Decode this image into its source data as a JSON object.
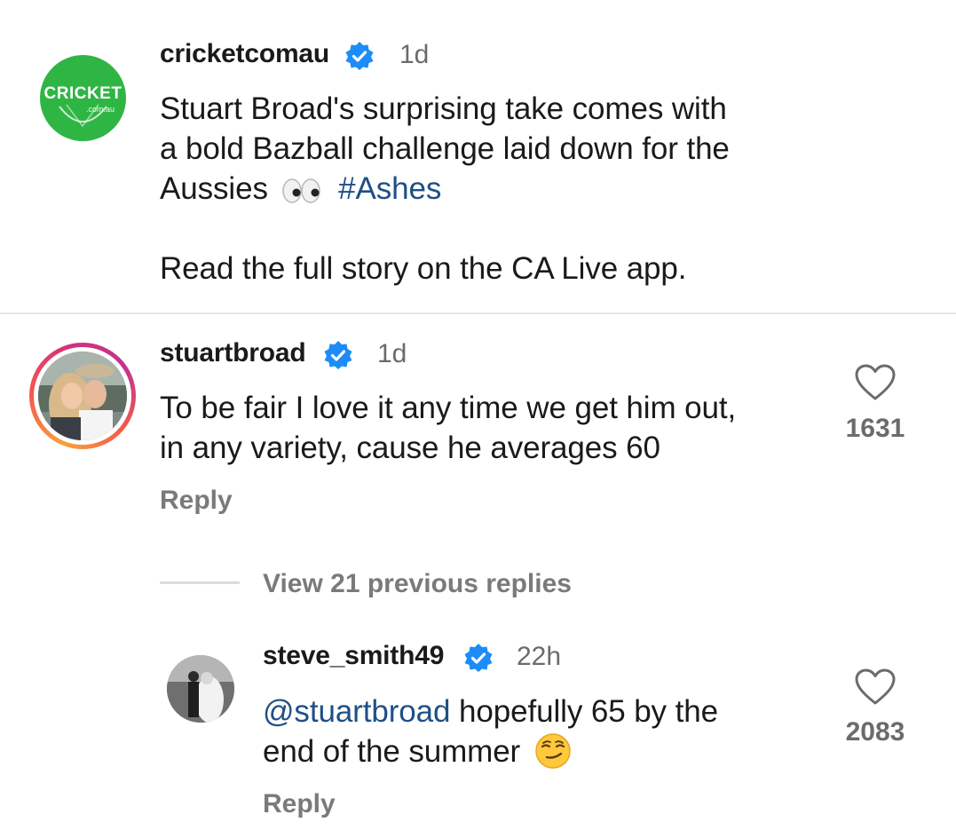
{
  "colors": {
    "verified_blue": "#1d8cf8",
    "link_blue": "#1f4f86",
    "cricket_green": "#2fb544",
    "muted_gray": "#6b6b6b"
  },
  "caption": {
    "username": "cricketcomau",
    "time": "1d",
    "avatar_logo_main": "CRICKET",
    "avatar_logo_sub": ".com.au",
    "line1": "Stuart Broad's surprising take comes with",
    "line2": "a bold Bazball challenge laid down for the",
    "line3_text": "Aussies",
    "line3_emoji_icon": "eyes-emoji-icon",
    "line3_hashtag": "#Ashes",
    "line4": "Read the full story on the CA Live app."
  },
  "comment1": {
    "username": "stuartbroad",
    "time": "1d",
    "line1": "To be fair I love it any time we get him out,",
    "line2": "in any variety, cause he averages 60",
    "reply_label": "Reply",
    "like_icon": "heart-icon",
    "likes": "1631"
  },
  "thread": {
    "view_replies_label": "View 21 previous replies"
  },
  "reply1": {
    "username": "steve_smith49",
    "time": "22h",
    "mention": "@stuartbroad",
    "line1_rest": " hopefully 65 by the",
    "line2": "end of the summer",
    "line2_emoji_icon": "smirk-emoji-icon",
    "reply_label": "Reply",
    "like_icon": "heart-icon",
    "likes": "2083"
  }
}
